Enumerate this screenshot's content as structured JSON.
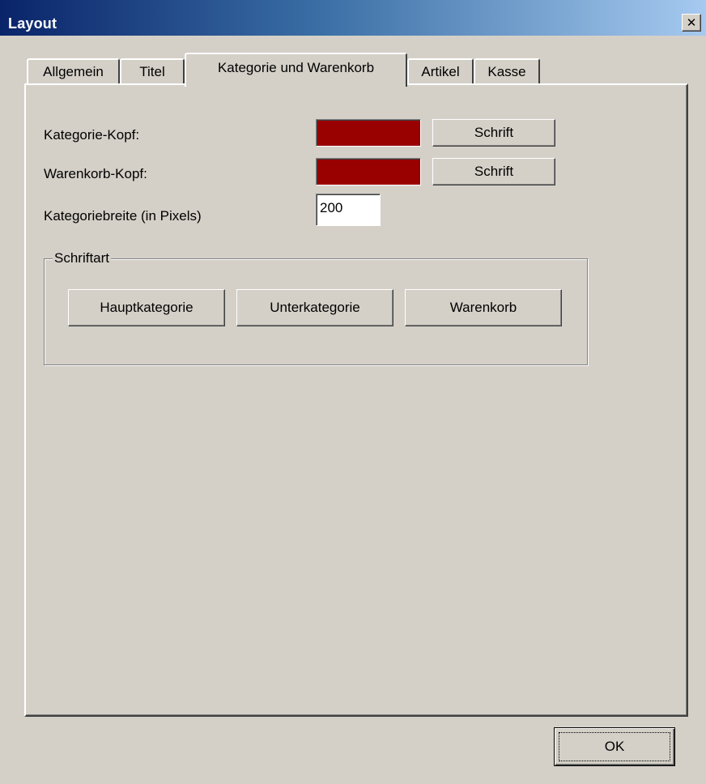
{
  "window": {
    "title": "Layout",
    "close_glyph": "✕"
  },
  "tabs": [
    {
      "label": "Allgemein",
      "active": false
    },
    {
      "label": "Titel",
      "active": false
    },
    {
      "label": "Kategorie und Warenkorb",
      "active": true
    },
    {
      "label": "Artikel",
      "active": false
    },
    {
      "label": "Kasse",
      "active": false
    }
  ],
  "panel": {
    "category_header_label": "Kategorie-Kopf:",
    "category_header_color": "#990000",
    "category_header_font_button": "Schrift",
    "cart_header_label": "Warenkorb-Kopf:",
    "cart_header_color": "#990000",
    "cart_header_font_button": "Schrift",
    "category_width_label": "Kategoriebreite (in Pixels)",
    "category_width_value": "200"
  },
  "font_group": {
    "legend": "Schriftart",
    "buttons": [
      "Hauptkategorie",
      "Unterkategorie",
      "Warenkorb"
    ]
  },
  "footer": {
    "ok_label": "OK"
  },
  "colors": {
    "title_gradient_start": "#0a246a",
    "title_gradient_end": "#a6caf0",
    "face": "#d4d0c8"
  }
}
